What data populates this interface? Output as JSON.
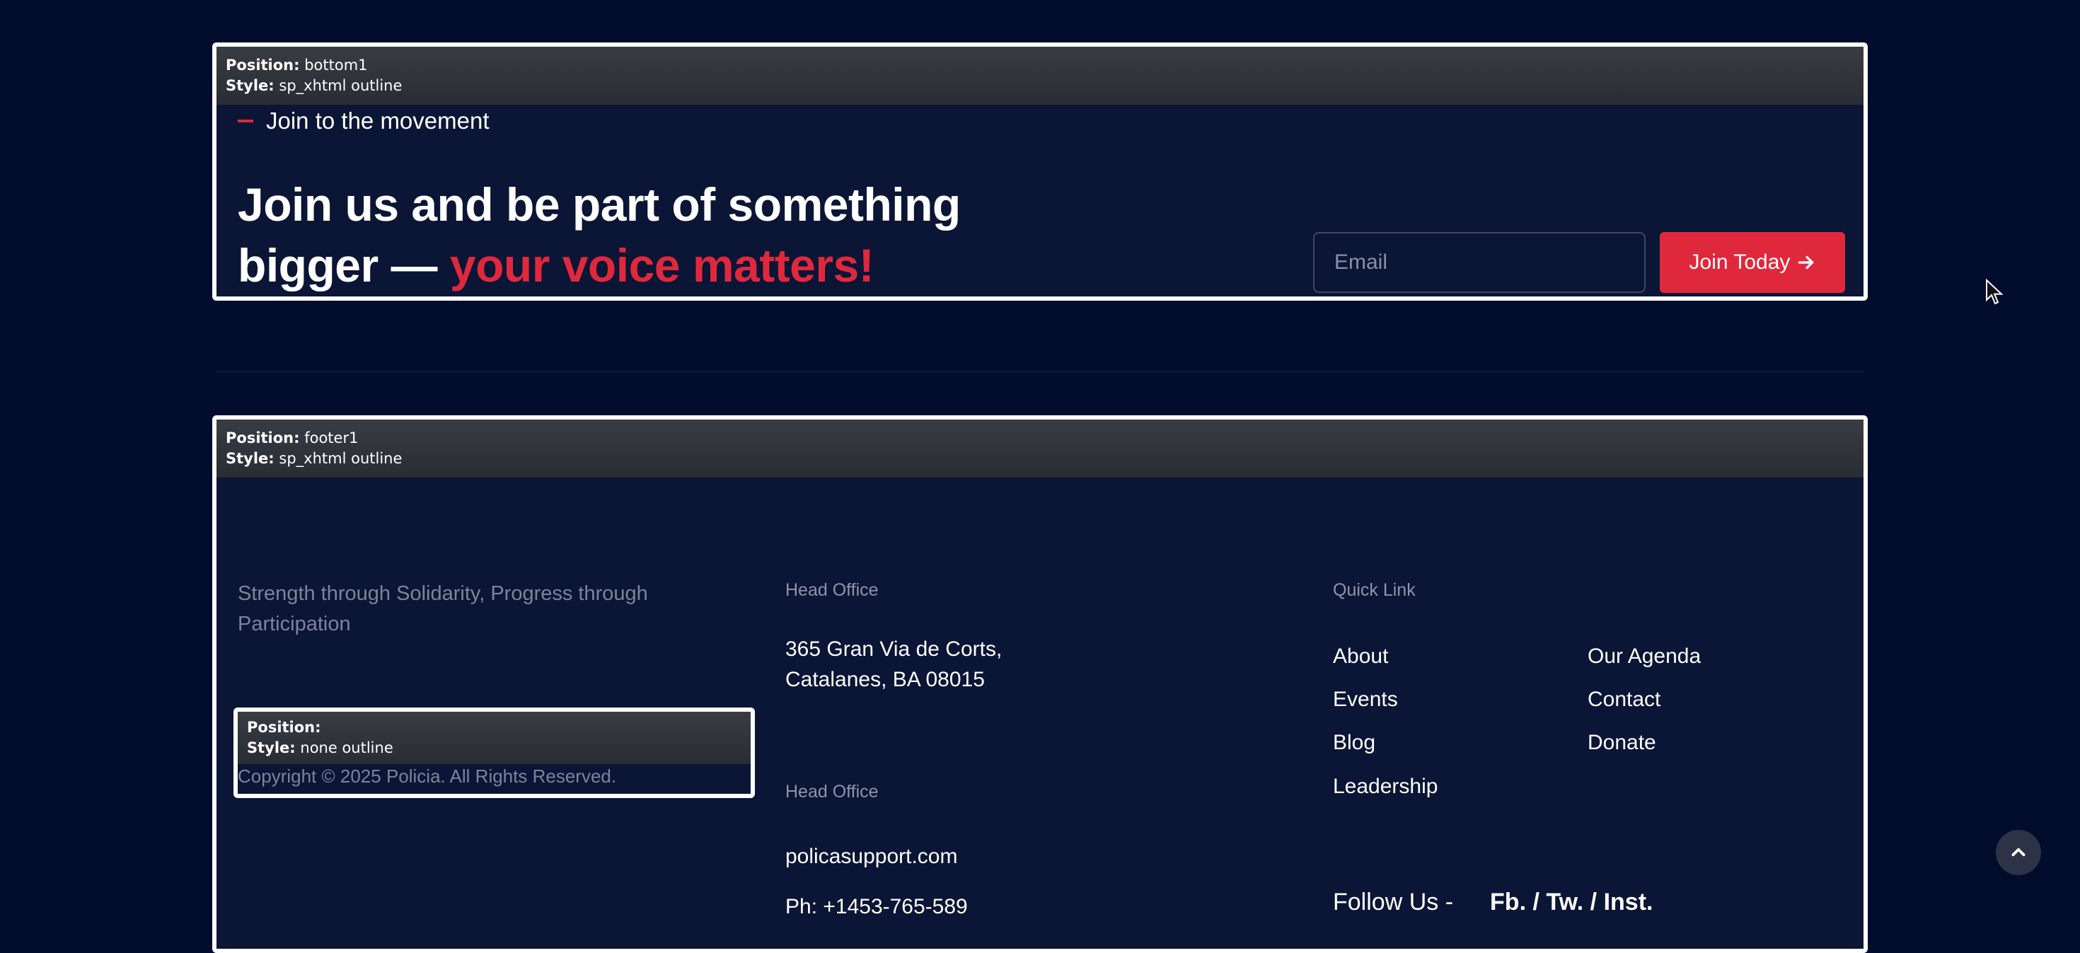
{
  "bottom1": {
    "position_label": "Position:",
    "position_value": "bottom1",
    "style_label": "Style:",
    "style_value": "sp_xhtml outline",
    "subtitle": "Join to the movement",
    "headline_line1": "Join us and be part of something",
    "headline_line2_prefix": "bigger — ",
    "headline_accent": "your voice matters!",
    "email_placeholder": "Email",
    "join_button_label": "Join Today",
    "accent_color": "#e0283d"
  },
  "footer1": {
    "position_label": "Position:",
    "position_value": "footer1",
    "style_label": "Style:",
    "style_value": "sp_xhtml outline",
    "tagline": "Strength through Solidarity, Progress through Participation",
    "inner_module": {
      "position_label": "Position:",
      "position_value": "",
      "style_label": "Style:",
      "style_value": "none outline",
      "copyright": "Copyright © 2025 Policia. All Rights Reserved."
    },
    "head_office_label_1": "Head Office",
    "address_line1": "365 Gran Via de Corts,",
    "address_line2": "Catalanes, BA 08015",
    "head_office_label_2": "Head Office",
    "website": "policasupport.com",
    "phone": "Ph: +1453-765-589",
    "quick_link_label": "Quick Link",
    "quick_links_col1": [
      "About",
      "Events",
      "Blog",
      "Leadership"
    ],
    "quick_links_col2": [
      "Our Agenda",
      "Contact",
      "Donate"
    ],
    "follow_label": "Follow Us -",
    "follow_links": "Fb. / Tw. / Inst."
  },
  "icons": {
    "join_arrow": "arrow-right-icon",
    "scroll_top": "chevron-up-icon",
    "cursor": "mouse-pointer-icon"
  },
  "colors": {
    "page_background": "#020d2e",
    "module_background": "#0b1535",
    "accent": "#e0283d"
  }
}
